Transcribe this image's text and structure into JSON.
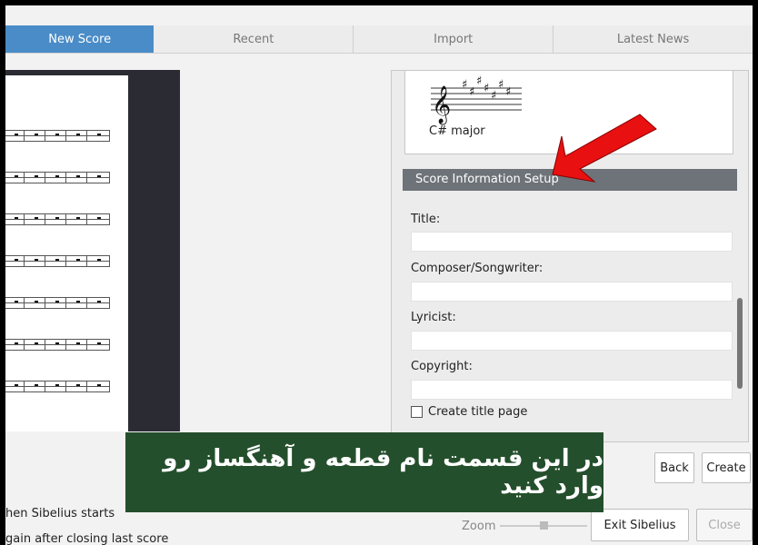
{
  "tabs": [
    {
      "label": "New Score",
      "active": true
    },
    {
      "label": "Recent"
    },
    {
      "label": "Import"
    },
    {
      "label": "Latest News"
    }
  ],
  "key_preview": {
    "label": "C# major"
  },
  "score_info": {
    "header": "Score Information Setup",
    "fields": [
      {
        "label": "Title:",
        "value": ""
      },
      {
        "label": "Composer/Songwriter:",
        "value": ""
      },
      {
        "label": "Lyricist:",
        "value": ""
      },
      {
        "label": "Copyright:",
        "value": ""
      }
    ],
    "checkbox": {
      "label": "Create title page",
      "checked": false
    }
  },
  "buttons": {
    "back": "Back",
    "create": "Create",
    "exit": "Exit Sibelius",
    "close": "Close"
  },
  "bottom": {
    "line1": "hen Sibelius starts",
    "line2": "gain after closing last score",
    "zoom_label": "Zoom"
  },
  "banner": {
    "text": "در این قسمت نام قطعه و آهنگساز رو وارد کنید"
  },
  "colors": {
    "active_tab": "#4a8cc7",
    "section_header": "#6d7378",
    "banner_bg": "#244f2c",
    "arrow": "#e81010"
  }
}
